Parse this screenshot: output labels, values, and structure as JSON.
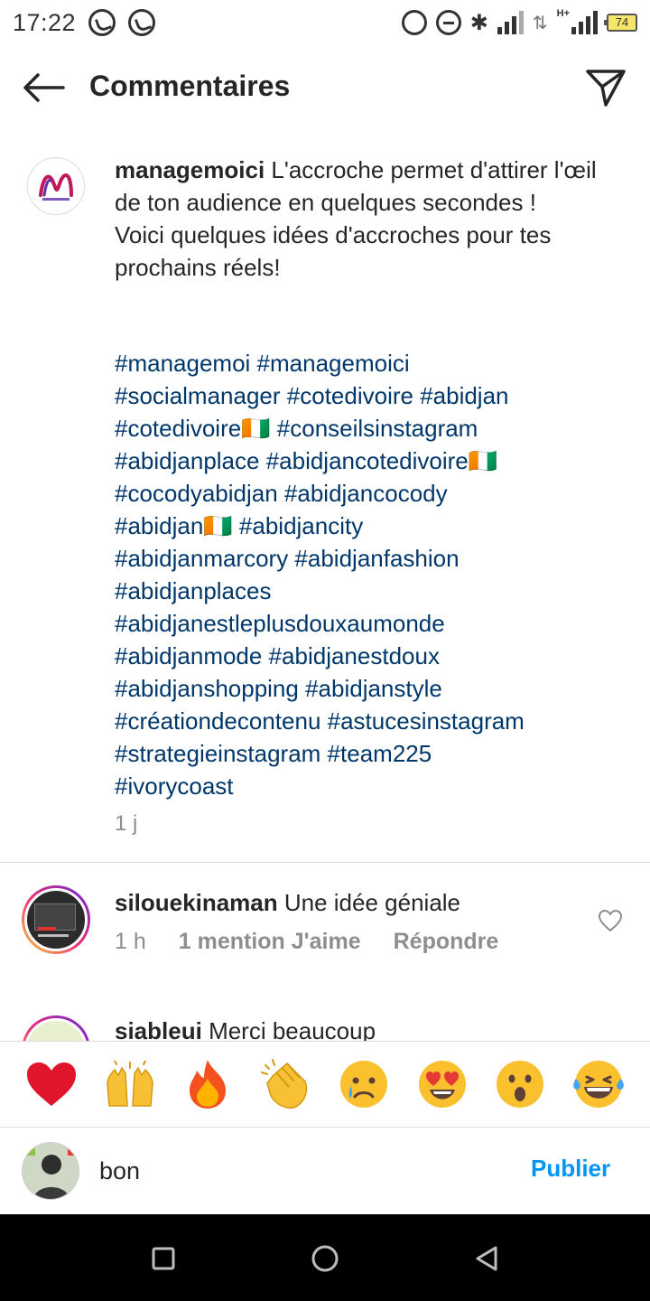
{
  "status_bar": {
    "time": "17:22",
    "battery": "74",
    "network_label": "H+"
  },
  "header": {
    "title": "Commentaires"
  },
  "caption": {
    "username": "managemoici",
    "text": "L'accroche permet d'attirer l'œil de ton audience en quelques secondes !\nVoici quelques idées d'accroches pour tes prochains réels!",
    "hashtag_lines": [
      "#managemoi #managemoici",
      "#socialmanager #cotedivoire #abidjan",
      "#cotedivoire🇨🇮 #conseilsinstagram",
      "#abidjanplace #abidjancotedivoire🇨🇮",
      "#cocodyabidjan #abidjancocody",
      "#abidjan🇨🇮 #abidjancity",
      "#abidjanmarcory #abidjanfashion",
      "#abidjanplaces",
      "#abidjanestleplusdouxaumonde",
      "#abidjanmode #abidjanestdoux",
      "#abidjanshopping #abidjanstyle",
      "#créationdecontenu #astucesinstagram",
      "#strategieinstagram #team225",
      "#ivorycoast"
    ],
    "time": "1 j"
  },
  "comments": [
    {
      "username": "silouekinaman",
      "text": "Une idée géniale",
      "time": "1 h",
      "likes": "1 mention J'aime",
      "reply": "Répondre"
    },
    {
      "username": "siableui",
      "text": "Merci beaucoup"
    }
  ],
  "emoji_bar": [
    {
      "name": "red-heart",
      "glyph": "❤️"
    },
    {
      "name": "raising-hands",
      "glyph": "🙌"
    },
    {
      "name": "fire",
      "glyph": "🔥"
    },
    {
      "name": "clapping-hands",
      "glyph": "👏"
    },
    {
      "name": "crying-face",
      "glyph": "😢"
    },
    {
      "name": "heart-eyes",
      "glyph": "😍"
    },
    {
      "name": "surprised-face",
      "glyph": "😮"
    },
    {
      "name": "laughing-tears",
      "glyph": "😂"
    }
  ],
  "composer": {
    "input_value": "bon",
    "publish_label": "Publier"
  },
  "colors": {
    "hashtag": "#00376b",
    "publish": "#0095f6",
    "meta_gray": "#8e8e8e"
  }
}
